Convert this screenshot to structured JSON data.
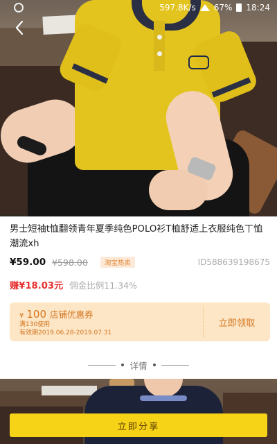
{
  "status_bar": {
    "speed": "597.8K/s",
    "battery": "67%",
    "time": "18:24"
  },
  "product": {
    "title": "男士短袖t恤翻领青年夏季纯色POLO衫T桖舒适上衣服纯色丅恤潮流xh",
    "price": "¥59.00",
    "original_price": "¥598.00",
    "tag": "淘宝热卖",
    "item_id": "ID588639198675",
    "earn": "赚¥18.03元",
    "commission": "佣金比例11.34%"
  },
  "coupon": {
    "currency": "¥",
    "amount": "100",
    "label": "店铺优惠券",
    "condition": "满130使用",
    "validity": "有效期2019.06.28-2019.07.31",
    "claim_label": "立即领取"
  },
  "details": {
    "label": "详情"
  },
  "actions": {
    "share_label": "立即分享"
  },
  "icons": {
    "back": "chevron-left-icon",
    "wifi": "wifi-icon",
    "battery": "battery-icon"
  },
  "colors": {
    "accent_yellow": "#f7d318",
    "earn_red": "#e83030",
    "coupon_bg": "#fde6c6",
    "coupon_text": "#d4751f"
  }
}
